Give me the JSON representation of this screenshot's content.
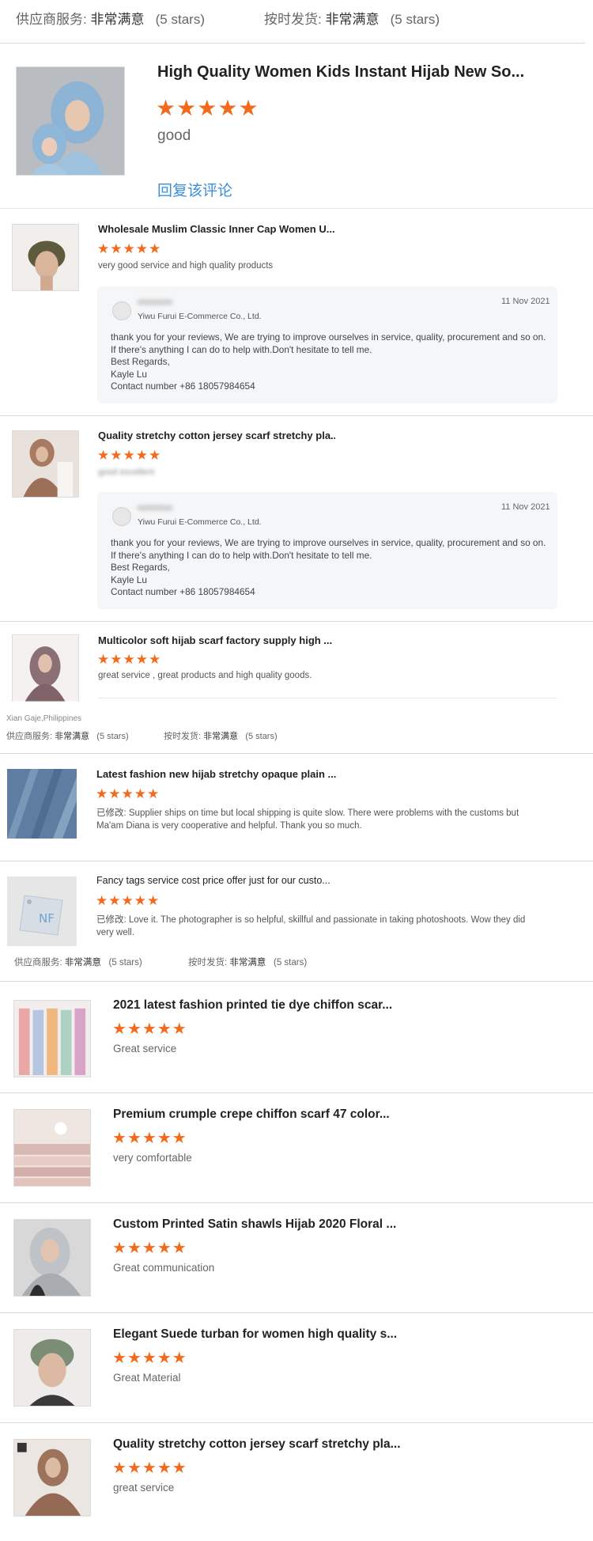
{
  "top_ratings": {
    "supplier_label": "供应商服务:",
    "supplier_value": "非常满意",
    "supplier_stars": "(5 stars)",
    "ontime_label": "按时发货:",
    "ontime_value": "非常满意",
    "ontime_stars": "(5 stars)"
  },
  "reviews": [
    {
      "title": "High Quality Women Kids Instant Hijab New So...",
      "stars": 5,
      "comment": "good",
      "reply_link": "回复该评论"
    },
    {
      "title": "Wholesale Muslim Classic Inner Cap Women U...",
      "stars": 5,
      "comment": "very good service and high quality products",
      "reply": {
        "date": "11 Nov 2021",
        "company": "Yiwu Furui E-Commerce Co., Ltd.",
        "lines": [
          "thank you for your reviews, We are trying to improve ourselves in service, quality, procurement and so on.",
          "If there's anything I can do to help with.Don't hesitate to tell me.",
          "Best Regards,",
          "Kayle Lu",
          "Contact number +86 18057984654"
        ]
      }
    },
    {
      "title": "Quality stretchy cotton jersey scarf stretchy pla...",
      "stars": 5,
      "comment_blurred": "good excellent",
      "reply": {
        "date": "11 Nov 2021",
        "company": "Yiwu Furui E-Commerce Co., Ltd.",
        "lines": [
          "thank you for your reviews, We are trying to improve ourselves in service, quality, procurement and so on.",
          "If there's anything I can do to help with.Don't hesitate to tell me.",
          "Best Regards,",
          "Kayle Lu",
          "Contact number +86 18057984654"
        ]
      }
    },
    {
      "title": "Multicolor soft hijab scarf factory supply high ...",
      "stars": 5,
      "comment": "great service , great products and high quality goods."
    }
  ],
  "reviewer_location": "Xian Gaje,Philippines",
  "mid_ratings": {
    "supplier_label": "供应商服务:",
    "supplier_value": "非常满意",
    "supplier_stars": "(5 stars)",
    "ontime_label": "按时发货:",
    "ontime_value": "非常满意",
    "ontime_stars": "(5 stars)"
  },
  "reviews2": [
    {
      "title": "Latest fashion new hijab stretchy opaque plain ...",
      "stars": 5,
      "comment_lines": [
        "已修改: Supplier ships on time but local shipping is quite slow. There were problems with the customs but",
        "Ma'am Diana is very cooperative and helpful. Thank you so much."
      ]
    },
    {
      "title": "Fancy tags service cost price offer just for our custo...",
      "stars": 5,
      "comment_lines": [
        "已修改: Love it. The photographer is so helpful, skillful and passionate in taking photoshoots. Wow they did",
        "very well."
      ],
      "thumb_text": "NF"
    }
  ],
  "lower_ratings": {
    "supplier_label": "供应商服务:",
    "supplier_value": "非常满意",
    "supplier_stars": "(5 stars)",
    "ontime_label": "按时发货:",
    "ontime_value": "非常满意",
    "ontime_stars": "(5 stars)"
  },
  "reviews3": [
    {
      "title": "2021 latest fashion printed tie dye chiffon scar...",
      "stars": 5,
      "comment": "Great service"
    },
    {
      "title": "Premium crumple crepe chiffon scarf 47 color...",
      "stars": 5,
      "comment": "very comfortable"
    },
    {
      "title": "Custom Printed Satin shawls Hijab 2020 Floral ...",
      "stars": 5,
      "comment": "Great communication"
    },
    {
      "title": "Elegant Suede turban for women high quality s...",
      "stars": 5,
      "comment": "Great Material"
    },
    {
      "title": "Quality stretchy cotton jersey scarf stretchy pla...",
      "stars": 5,
      "comment": "great service"
    }
  ],
  "colors": {
    "star": "#f26b1d",
    "link": "#3b8fd6",
    "reply_bg": "#f5f6f8",
    "divider": "#d8d8d8"
  },
  "icons": {
    "star": "star-icon",
    "avatar": "avatar-icon"
  }
}
